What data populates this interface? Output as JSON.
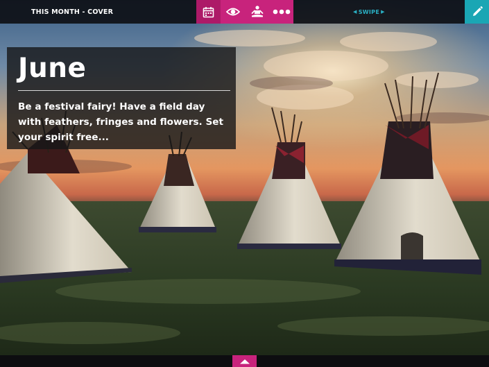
{
  "header": {
    "section_title": "THIS MONTH - COVER",
    "swipe_label": "SWIPE"
  },
  "toolbar": {
    "buttons": [
      {
        "icon": "calendar-icon"
      },
      {
        "icon": "eye-icon"
      },
      {
        "icon": "meditation-icon"
      },
      {
        "icon": "more-icon"
      }
    ],
    "edit_icon": "pencil-icon",
    "bottom_icon": "chevron-up-icon"
  },
  "card": {
    "title": "June",
    "text": "Be a festival fairy! Have a field day with feathers, fringes and flowers. Set your spirit free..."
  },
  "colors": {
    "accent_magenta": "#c8237c",
    "accent_teal": "#1aa6b4",
    "swipe_text": "#2ab0c4"
  }
}
